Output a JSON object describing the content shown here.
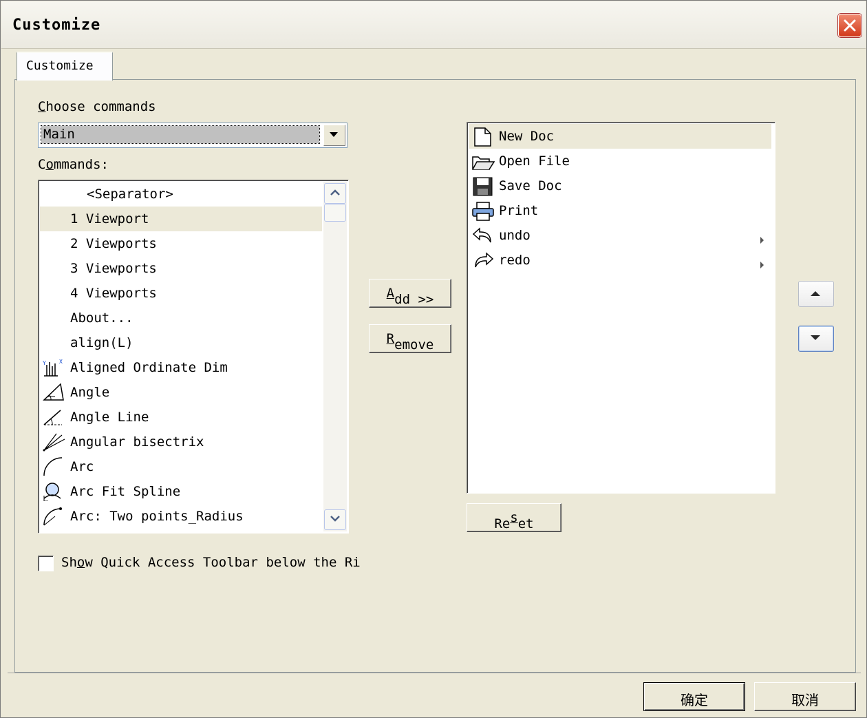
{
  "window": {
    "title": "Customize"
  },
  "tab": {
    "label": "Customize"
  },
  "choose_commands": {
    "label": "Choose commands",
    "selected": "Main"
  },
  "commands": {
    "label": "Commands:",
    "items": [
      {
        "label": "<Separator>",
        "icon": "",
        "selected": false
      },
      {
        "label": "1 Viewport",
        "icon": "",
        "selected": true
      },
      {
        "label": "2 Viewports",
        "icon": "",
        "selected": false
      },
      {
        "label": "3 Viewports",
        "icon": "",
        "selected": false
      },
      {
        "label": "4 Viewports",
        "icon": "",
        "selected": false
      },
      {
        "label": "About...",
        "icon": "",
        "selected": false
      },
      {
        "label": "align(L)",
        "icon": "",
        "selected": false
      },
      {
        "label": "Aligned Ordinate Dim",
        "icon": "ordinate-dim-icon",
        "selected": false
      },
      {
        "label": "Angle",
        "icon": "angle-icon",
        "selected": false
      },
      {
        "label": "Angle Line",
        "icon": "angle-line-icon",
        "selected": false
      },
      {
        "label": "Angular bisectrix",
        "icon": "bisectrix-icon",
        "selected": false
      },
      {
        "label": "Arc",
        "icon": "arc-icon",
        "selected": false
      },
      {
        "label": "Arc Fit Spline",
        "icon": "arc-fit-spline-icon",
        "selected": false
      },
      {
        "label": "Arc: Two points_Radius",
        "icon": "arc-two-points-icon",
        "selected": false
      }
    ]
  },
  "buttons": {
    "add": "Add >>",
    "remove": "Remove",
    "reset": "Reset",
    "ok": "确定",
    "cancel": "取消"
  },
  "quick_access": {
    "items": [
      {
        "label": "New Doc",
        "icon": "new-doc-icon",
        "submenu": false,
        "selected": true
      },
      {
        "label": "Open File",
        "icon": "open-folder-icon",
        "submenu": false,
        "selected": false
      },
      {
        "label": "Save Doc",
        "icon": "save-icon",
        "submenu": false,
        "selected": false
      },
      {
        "label": "Print",
        "icon": "print-icon",
        "submenu": false,
        "selected": false
      },
      {
        "label": "undo",
        "icon": "undo-icon",
        "submenu": true,
        "selected": false
      },
      {
        "label": "redo",
        "icon": "redo-icon",
        "submenu": true,
        "selected": false
      }
    ]
  },
  "show_below_ribbon": {
    "label": "Show Quick Access Toolbar below the Ri",
    "checked": false
  }
}
